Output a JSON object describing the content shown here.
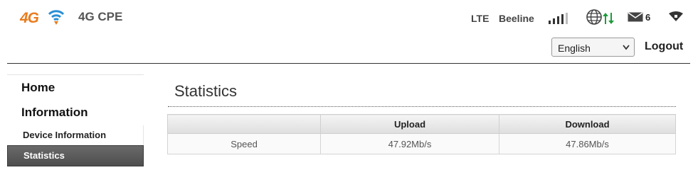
{
  "header": {
    "logo_text": "4G",
    "product_name": "4G CPE",
    "network_type": "LTE",
    "operator": "Beeline",
    "sms_count": "6"
  },
  "language": {
    "selected": "English"
  },
  "logout_label": "Logout",
  "sidebar": {
    "items": [
      {
        "label": "Home"
      },
      {
        "label": "Information"
      }
    ],
    "sub_items": [
      {
        "label": "Device Information"
      },
      {
        "label": "Statistics"
      }
    ]
  },
  "main": {
    "title": "Statistics",
    "table": {
      "headers": [
        "",
        "Upload",
        "Download"
      ],
      "rows": [
        {
          "label": "Speed",
          "upload": "47.92Mb/s",
          "download": "47.86Mb/s"
        }
      ]
    }
  },
  "colors": {
    "accent_orange": "#e87c1e",
    "wifi_blue": "#2a8fd6",
    "upload_arrow_green": "#1e9b3c",
    "active_item_bg": "#5a5a5a"
  },
  "icons": {
    "logo_wifi": "wifi-logo-icon",
    "signal": "signal-strength-icon",
    "globe": "globe-icon",
    "transfer": "updown-arrows-icon",
    "mail": "mail-icon",
    "wifi_status": "wifi-status-icon"
  }
}
